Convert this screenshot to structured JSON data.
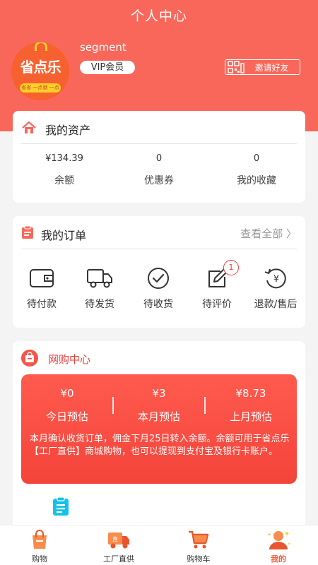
{
  "header": {
    "title": "个人中心"
  },
  "profile": {
    "logo": {
      "brand": "省点乐",
      "slogan": "省省 一点就 一点"
    },
    "username": "segment",
    "vip_label": "VIP会员",
    "invite_label": "邀请好友"
  },
  "assets": {
    "title": "我的资产",
    "stats": [
      {
        "value": "¥134.39",
        "label": "余额"
      },
      {
        "value": "0",
        "label": "优惠券"
      },
      {
        "value": "0",
        "label": "我的收藏"
      }
    ]
  },
  "orders": {
    "title": "我的订单",
    "view_all": "查看全部 〉",
    "items": [
      {
        "label": "待付款",
        "icon": "wallet-icon"
      },
      {
        "label": "待发货",
        "icon": "truck-icon"
      },
      {
        "label": "待收货",
        "icon": "check-circle-icon"
      },
      {
        "label": "待评价",
        "icon": "edit-icon",
        "badge": "1"
      },
      {
        "label": "退款/售后",
        "icon": "refund-icon"
      }
    ]
  },
  "shop": {
    "title": "网购中心",
    "earnings": [
      {
        "amount": "¥0",
        "label": "今日预估"
      },
      {
        "amount": "¥3",
        "label": "本月预估"
      },
      {
        "amount": "¥8.73",
        "label": "上月预估"
      }
    ],
    "note": "本月确认收货订单，佣金下月25日转入余额。余额可用于省点乐【工厂直供】商城购物，也可以提现到支付宝及银行卡账户。"
  },
  "tabbar": {
    "items": [
      {
        "label": "购物",
        "icon": "shopping-bag-icon",
        "active": false
      },
      {
        "label": "工厂直供",
        "icon": "factory-truck-icon",
        "active": false
      },
      {
        "label": "购物车",
        "icon": "cart-icon",
        "active": false
      },
      {
        "label": "我的",
        "icon": "profile-icon",
        "active": true
      }
    ]
  },
  "colors": {
    "primary": "#f9675a",
    "accent": "#e94040",
    "gradient_end": "#f4443a",
    "tab_active": "#f25a3a"
  }
}
